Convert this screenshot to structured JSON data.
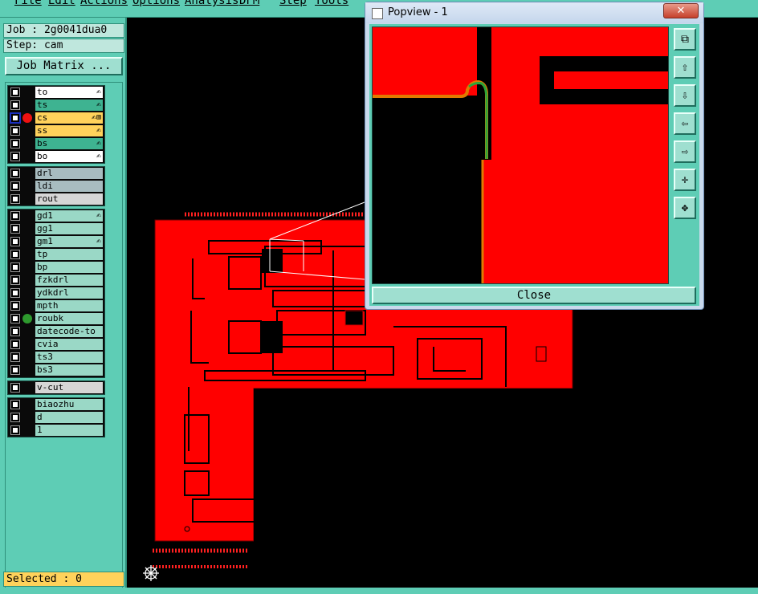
{
  "menubar": {
    "items": [
      "File",
      "Edit",
      "Actions",
      "Options",
      "Analysis",
      "DFM",
      "Step",
      "Tools"
    ]
  },
  "job": {
    "label": "Job : 2g0041dua0"
  },
  "step": {
    "label": "Step: cam"
  },
  "job_matrix": {
    "label": "Job Matrix ..."
  },
  "layers": {
    "board": [
      {
        "name": "to",
        "cls": "white",
        "icon": "✍"
      },
      {
        "name": "ts",
        "cls": "brd",
        "icon": "✍"
      },
      {
        "name": "cs",
        "cls": "orange",
        "icon": "✍⊞"
      },
      {
        "name": "ss",
        "cls": "orange",
        "icon": "✍"
      },
      {
        "name": "bs",
        "cls": "brd",
        "icon": "✍"
      },
      {
        "name": "bo",
        "cls": "white",
        "icon": "✍"
      }
    ],
    "drill": [
      {
        "name": "drl",
        "cls": "dril"
      },
      {
        "name": "ldi",
        "cls": "dril"
      },
      {
        "name": "rout",
        "cls": "rout"
      }
    ],
    "misc": [
      {
        "name": "gd1",
        "cls": "ctx",
        "icon": "✍"
      },
      {
        "name": "gg1",
        "cls": "ctx"
      },
      {
        "name": "gm1",
        "cls": "ctx",
        "icon": "✍"
      },
      {
        "name": "tp",
        "cls": "ctx"
      },
      {
        "name": "bp",
        "cls": "ctx"
      },
      {
        "name": "fzkdrl",
        "cls": "ctx"
      },
      {
        "name": "ydkdrl",
        "cls": "ctx"
      },
      {
        "name": "mpth",
        "cls": "ctx"
      },
      {
        "name": "roubk",
        "cls": "ctx"
      },
      {
        "name": "datecode-to",
        "cls": "ctx"
      },
      {
        "name": "cvia",
        "cls": "ctx"
      },
      {
        "name": "ts3",
        "cls": "ctx"
      },
      {
        "name": "bs3",
        "cls": "ctx"
      }
    ],
    "vcut": [
      {
        "name": "v-cut",
        "cls": "rout"
      }
    ],
    "other": [
      {
        "name": "biaozhu",
        "cls": "ctx"
      },
      {
        "name": "d",
        "cls": "ctx"
      },
      {
        "name": "1",
        "cls": "ctx"
      }
    ]
  },
  "selected": {
    "label": "Selected : 0"
  },
  "popview": {
    "title": "Popview - 1",
    "close_x": "✕",
    "close_button": "Close"
  },
  "colors": {
    "copper": "#ff0000",
    "panel": "#5ecdb5",
    "highlight": "#ffd25b"
  }
}
